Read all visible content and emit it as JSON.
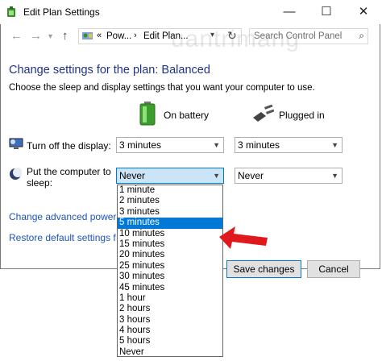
{
  "window": {
    "title": "Edit Plan Settings"
  },
  "titlebar": {
    "minimize": "—",
    "maximize": "☐",
    "close": "✕"
  },
  "nav": {
    "path": [
      "Pow...",
      "Edit Plan..."
    ],
    "search_placeholder": "Search Control Panel"
  },
  "watermark": "uantrimang",
  "main": {
    "heading": "Change settings for the plan: Balanced",
    "subheading": "Choose the sleep and display settings that you want your computer to use.",
    "col_battery": "On battery",
    "col_plugged": "Plugged in",
    "display_label": "Turn off the display:",
    "display_battery": "3 minutes",
    "display_plugged": "3 minutes",
    "sleep_label_line1": "Put the computer to",
    "sleep_label_line2": "sleep:",
    "sleep_battery": "Never",
    "sleep_plugged": "Never",
    "link_advanced": "Change advanced power settings",
    "link_restore": "Restore default settings for this plan",
    "save_button": "Save changes",
    "cancel_button": "Cancel"
  },
  "dropdown": {
    "options": [
      "1 minute",
      "2 minutes",
      "3 minutes",
      "5 minutes",
      "10 minutes",
      "15 minutes",
      "20 minutes",
      "25 minutes",
      "30 minutes",
      "45 minutes",
      "1 hour",
      "2 hours",
      "3 hours",
      "4 hours",
      "5 hours",
      "Never"
    ],
    "highlighted": "5 minutes"
  },
  "colors": {
    "accent": "#0078d7",
    "heading": "#1e3287",
    "link": "#1c55b8",
    "arrow": "#e0191d"
  }
}
